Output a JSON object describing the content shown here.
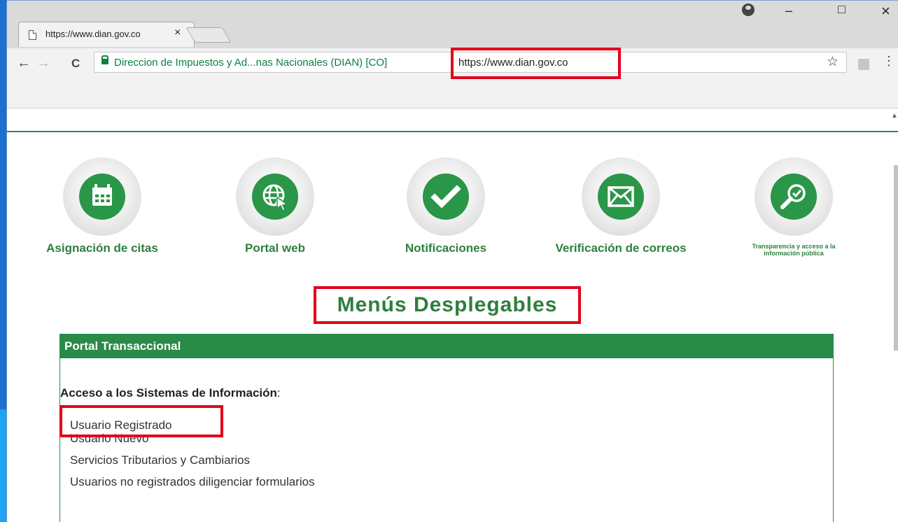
{
  "browser": {
    "tab_title": "https://www.dian.gov.co",
    "tab_close": "×",
    "site_identity": "Direccion de Impuestos y Ad...nas Nacionales (DIAN) [CO]",
    "url": "https://www.dian.gov.co",
    "controls": {
      "minimize": "–",
      "maximize": "□",
      "close": "×",
      "back": "←",
      "forward": "→",
      "reload": "C",
      "star": "☆",
      "menu": "⋮"
    }
  },
  "services": [
    {
      "label": "Asignación de citas",
      "icon": "calendar-icon"
    },
    {
      "label": "Portal web",
      "icon": "globe-cursor-icon"
    },
    {
      "label": "Notificaciones",
      "icon": "checkmark-icon"
    },
    {
      "label": "Verificación de correos",
      "icon": "envelope-icon"
    },
    {
      "label": "Transparencia y acceso a la información pública",
      "icon": "magnifier-check-icon"
    }
  ],
  "section_title": "Menús Desplegables",
  "panel": {
    "header": "Portal Transaccional",
    "subtitle_bold": "Acceso a los Sistemas de Información",
    "subtitle_suffix": ":",
    "links": [
      "Usuario Registrado",
      "Usuario Nuevo",
      "Servicios Tributarios y Cambiarios",
      "Usuarios no registrados diligenciar formularios"
    ]
  },
  "colors": {
    "brand_green": "#2a8a47",
    "highlight_red": "#e3001b"
  }
}
